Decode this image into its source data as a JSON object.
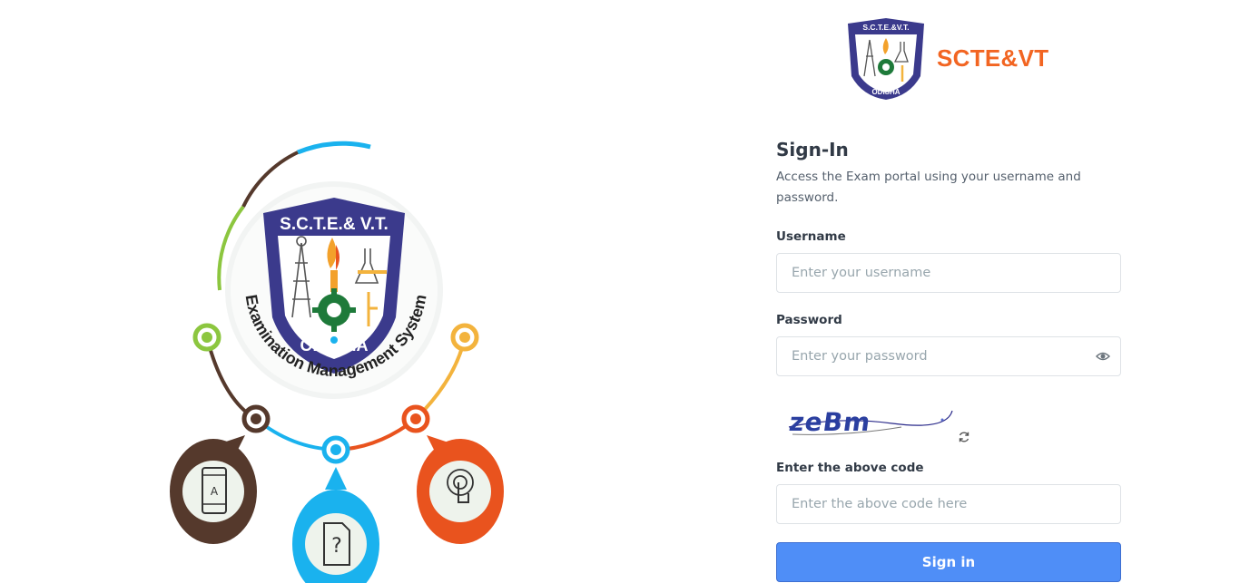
{
  "brand": {
    "name": "SCTE&VT",
    "logo_text_top": "S.C.T.E.&V.T.",
    "logo_text_bottom": "ODISHA",
    "accent_color": "#f26522"
  },
  "illustration": {
    "emblem_top": "S.C.T.E.& V.T.",
    "emblem_bottom": "ODI SHA",
    "arc_caption": "Examination Management System",
    "colors": {
      "blue": "#1ab2ee",
      "brown": "#55392c",
      "green": "#8cc63f",
      "orange": "#e9531e",
      "yellow": "#f3b33d",
      "navy": "#3b3a8c"
    }
  },
  "signin": {
    "title": "Sign-In",
    "subtitle": "Access the Exam portal using your username and password.",
    "username_label": "Username",
    "username_placeholder": "Enter your username",
    "password_label": "Password",
    "password_placeholder": "Enter your password",
    "captcha_text": "zeBm",
    "captcha_label": "Enter the above code",
    "captcha_placeholder": "Enter the above code here",
    "submit_label": "Sign in"
  }
}
